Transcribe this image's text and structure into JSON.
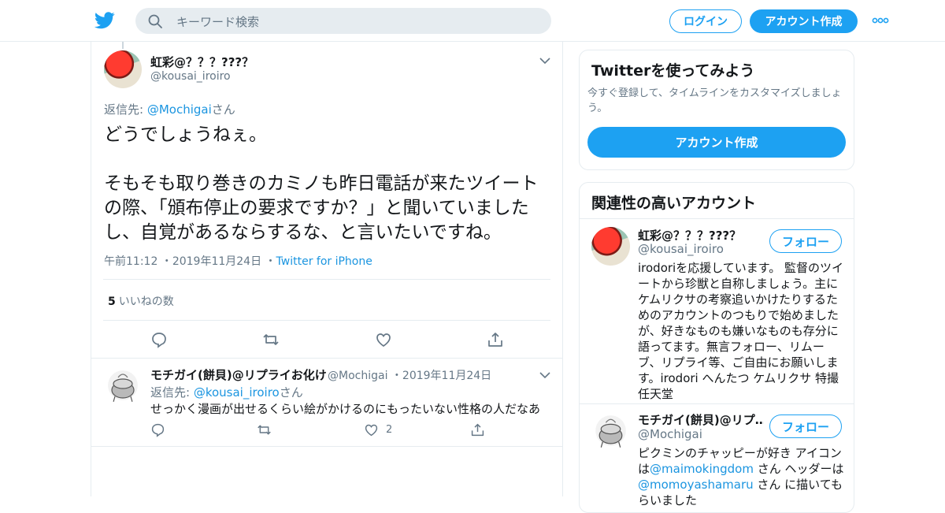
{
  "header": {
    "search_placeholder": "キーワード検索",
    "login_label": "ログイン",
    "signup_label": "アカウント作成"
  },
  "main_tweet": {
    "name": "虹彩@？？？???？",
    "handle": "@kousai_iroiro",
    "reply_prefix": "返信先: ",
    "reply_to": "@Mochigai",
    "reply_suffix": "さん",
    "text": "どうでしょうねぇ。\n\nそもそも取り巻きのカミノも昨日電話が来たツイートの際、「頒布停止の要求ですか？」と聞いていましたし、自覚があるならするな、と言いたいですね。",
    "time": "午前11:12",
    "date": "2019年11月24日",
    "source": "Twitter for iPhone",
    "likes_count": "5",
    "likes_label": "いいねの数"
  },
  "reply_tweet": {
    "name": "モチガイ(餅貝)@リプライお化け",
    "handle": "@Mochigai",
    "date": "2019年11月24日",
    "reply_prefix": "返信先: ",
    "reply_to": "@kousai_iroiro",
    "reply_suffix": "さん",
    "text": "せっかく漫画が出せるくらい絵がかけるのにもったいない性格の人だなあ",
    "like_count": "2"
  },
  "signup_card": {
    "title": "Twitterを使ってみよう",
    "desc": "今すぐ登録して、タイムラインをカスタマイズしましょう。",
    "button": "アカウント作成"
  },
  "related_card": {
    "title": "関連性の高いアカウント",
    "follow_label": "フォロー",
    "accounts": [
      {
        "name": "虹彩@？？？???？",
        "handle": "@kousai_iroiro",
        "bio": "irodoriを応援しています。 監督のツイートから珍獣と自称しましょう。主にケムリクサの考察追いかけたりするためのアカウントのつもりで始めましたが、好きなものも嫌いなものも存分に語ってます。無言フォロー、リムーブ、リプライ等、ご自由にお願いします。irodori へんたつ ケムリクサ 特撮 任天堂"
      },
      {
        "name": "モチガイ(餅貝)@リプ…",
        "handle": "@Mochigai",
        "bio_part1": "ピクミンのチャッピーが好き アイコンは",
        "bio_link1": "@maimokingdom",
        "bio_part2": " さん ヘッダーは",
        "bio_link2": "@momoyashamaru",
        "bio_part3": " さん に描いてもらいました"
      }
    ]
  },
  "colors": {
    "accent": "#1da1f2",
    "link": "#1b95e0",
    "secondary_text": "#657786",
    "border": "#e6ecf0"
  },
  "icons": [
    "twitter-bird-icon",
    "search-icon",
    "more-dots-icon",
    "chevron-down-icon",
    "reply-icon",
    "retweet-icon",
    "like-icon",
    "share-icon"
  ]
}
